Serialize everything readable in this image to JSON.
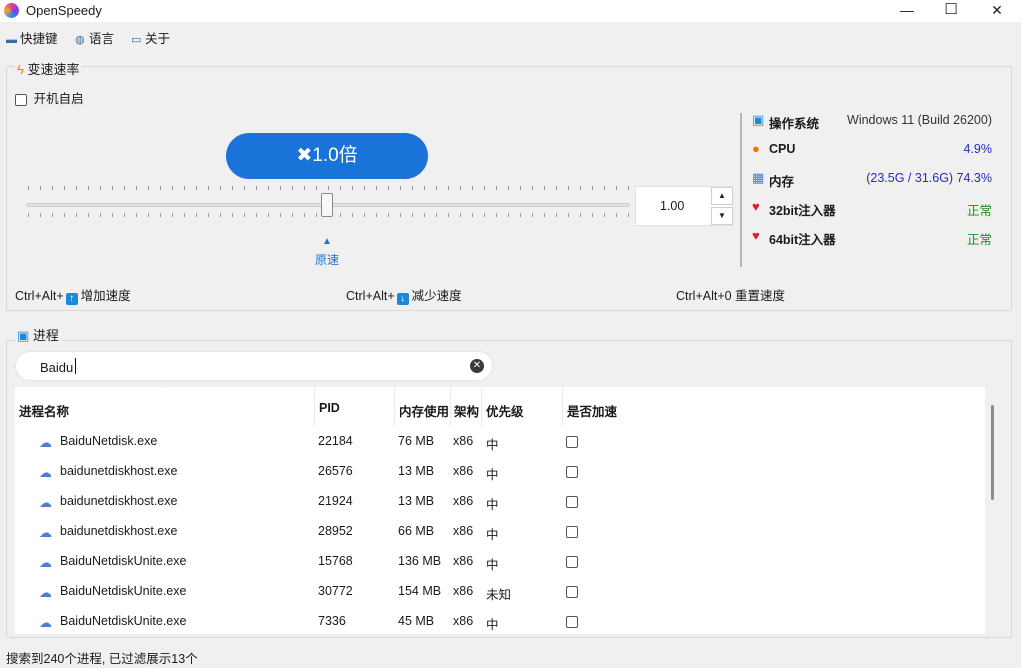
{
  "window": {
    "title": "OpenSpeedy",
    "controls": [
      "—",
      "☐",
      "✕"
    ]
  },
  "menu": [
    {
      "label": "快捷键",
      "icon": "keyboard-icon"
    },
    {
      "label": "语言",
      "icon": "globe-icon"
    },
    {
      "label": "关于",
      "icon": "book-icon"
    }
  ],
  "speed_panel": {
    "title": "变速速率",
    "title_icon": "lightning-icon",
    "autostart_label": "开机自启",
    "autostart_checked": false,
    "speed_button_label": "✖1.0倍",
    "slider_value": 1.0,
    "origin_label": "原速",
    "spin_value": "1.00",
    "spin_up": "▲",
    "spin_down": "▼",
    "hotkeys": {
      "increase_prefix": "Ctrl+Alt+",
      "increase_label": "增加速度",
      "decrease_prefix": "Ctrl+Alt+",
      "decrease_label": "减少速度",
      "reset_label": "Ctrl+Alt+0 重置速度"
    }
  },
  "system_info": [
    {
      "icon": "monitor-icon",
      "label": "操作系统",
      "value": "Windows 11 (Build 26200)",
      "color": "#333333"
    },
    {
      "icon": "fire-icon",
      "label": "CPU",
      "value": "4.9%",
      "color": "#2a2ac0"
    },
    {
      "icon": "chart-icon",
      "label": "内存",
      "value": "(23.5G / 31.6G) 74.3%",
      "color": "#2a2ac0"
    },
    {
      "icon": "heart-icon",
      "label": "32bit注入器",
      "value": "正常",
      "color": "#1e8c1e"
    },
    {
      "icon": "heart-icon",
      "label": "64bit注入器",
      "value": "正常",
      "color": "#1e8c1e"
    }
  ],
  "process_panel": {
    "title": "进程",
    "title_icon": "monitor-icon",
    "search_value": "Baidu",
    "clear_symbol": "✕",
    "columns": [
      "进程名称",
      "PID",
      "内存使用",
      "架构",
      "优先级",
      "是否加速"
    ],
    "rows": [
      {
        "name": "BaiduNetdisk.exe",
        "pid": "22184",
        "memory": "76 MB",
        "arch": "x86",
        "priority": "中",
        "accelerated": false
      },
      {
        "name": "baidunetdiskhost.exe",
        "pid": "26576",
        "memory": "13 MB",
        "arch": "x86",
        "priority": "中",
        "accelerated": false
      },
      {
        "name": "baidunetdiskhost.exe",
        "pid": "21924",
        "memory": "13 MB",
        "arch": "x86",
        "priority": "中",
        "accelerated": false
      },
      {
        "name": "baidunetdiskhost.exe",
        "pid": "28952",
        "memory": "66 MB",
        "arch": "x86",
        "priority": "中",
        "accelerated": false
      },
      {
        "name": "BaiduNetdiskUnite.exe",
        "pid": "15768",
        "memory": "136 MB",
        "arch": "x86",
        "priority": "中",
        "accelerated": false
      },
      {
        "name": "BaiduNetdiskUnite.exe",
        "pid": "30772",
        "memory": "154 MB",
        "arch": "x86",
        "priority": "未知",
        "accelerated": false
      },
      {
        "name": "BaiduNetdiskUnite.exe",
        "pid": "7336",
        "memory": "45 MB",
        "arch": "x86",
        "priority": "中",
        "accelerated": false
      }
    ]
  },
  "status_bar": "搜索到240个进程, 已过滤展示13个"
}
